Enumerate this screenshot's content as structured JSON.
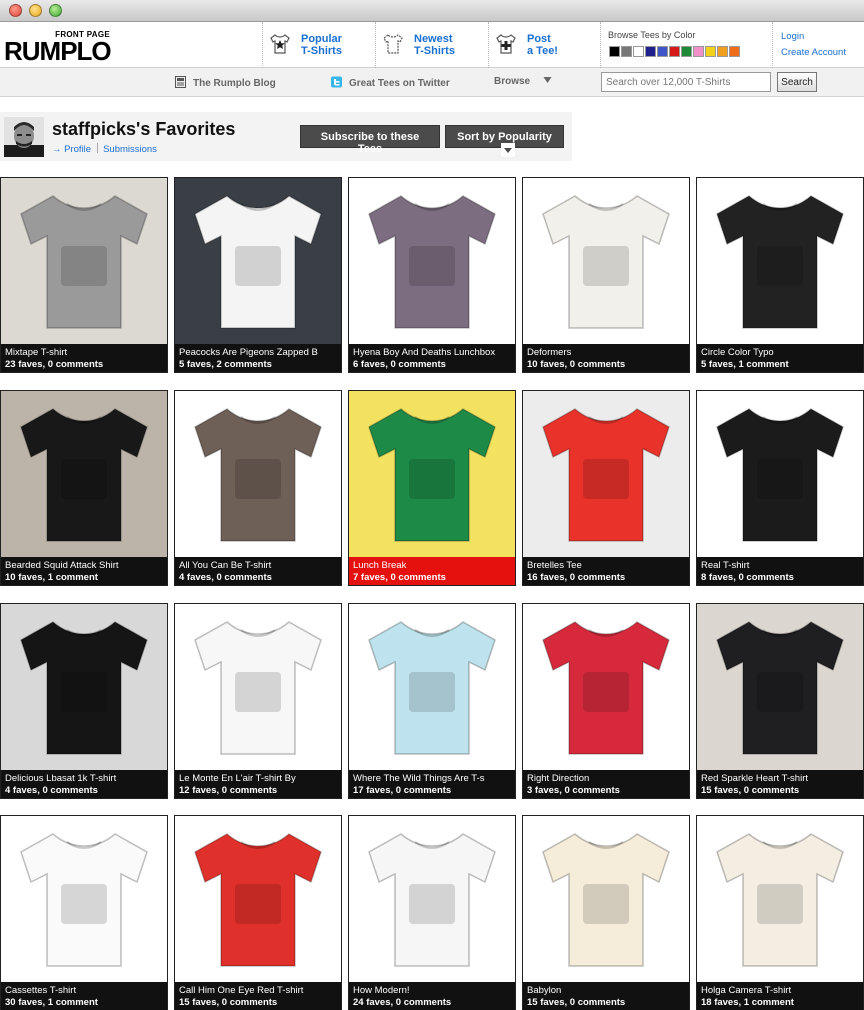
{
  "window": {
    "controls": [
      "close",
      "minimize",
      "zoom"
    ]
  },
  "header": {
    "logo_small": "FRONT PAGE",
    "logo": "RUMPLO",
    "nav": [
      {
        "label": "Popular\nT-Shirts",
        "icon": "star-shirt-icon"
      },
      {
        "label": "Newest\nT-Shirts",
        "icon": "shirt-outline-icon"
      },
      {
        "label": "Post\na Tee!",
        "icon": "plus-shirt-icon"
      }
    ],
    "browse_color_label": "Browse Tees by Color",
    "colors": [
      "#000000",
      "#777777",
      "#ffffff",
      "#1e1e8c",
      "#3d55c8",
      "#d61a1a",
      "#1f8a35",
      "#f08fc8",
      "#f2d21a",
      "#f0a01e",
      "#ee6c1a"
    ],
    "login": "Login",
    "create_account": "Create Account"
  },
  "subnav": {
    "blog": "The Rumplo Blog",
    "twitter": "Great Tees on Twitter",
    "browse": "Browse",
    "search_placeholder": "Search over 12,000 T-Shirts",
    "search_button": "Search"
  },
  "profile": {
    "title": "staffpicks's Favorites",
    "arrow": "→",
    "profile_link": "Profile",
    "submissions_link": "Submissions",
    "subscribe_button": "Subscribe to these Tees",
    "sort_button": "Sort by Popularity"
  },
  "items": [
    {
      "title": "Mixtape T-shirt",
      "meta": "23 faves, 0 comments",
      "bg": "#dcd8d2",
      "shirt": "#9a9a9a",
      "highlight": false
    },
    {
      "title": "Peacocks Are Pigeons Zapped B",
      "meta": "5 faves, 2 comments",
      "bg": "#3a3f46",
      "shirt": "#f4f4f4",
      "highlight": false
    },
    {
      "title": "Hyena Boy And Deaths Lunchbox",
      "meta": "6 faves, 0 comments",
      "bg": "#ffffff",
      "shirt": "#7d6d80",
      "highlight": false
    },
    {
      "title": "Deformers",
      "meta": "10 faves, 0 comments",
      "bg": "#ffffff",
      "shirt": "#f2f0ea",
      "highlight": false
    },
    {
      "title": "Circle Color Typo",
      "meta": "5 faves, 1 comment",
      "bg": "#ffffff",
      "shirt": "#222222",
      "highlight": false
    },
    {
      "title": "Bearded Squid Attack Shirt",
      "meta": "10 faves, 1 comment",
      "bg": "#bcb4a8",
      "shirt": "#181818",
      "highlight": false
    },
    {
      "title": "All You Can Be T-shirt",
      "meta": "4 faves, 0 comments",
      "bg": "#ffffff",
      "shirt": "#6e5f57",
      "highlight": false
    },
    {
      "title": "Lunch Break",
      "meta": "7 faves, 0 comments",
      "bg": "#f3e160",
      "shirt": "#1d8a48",
      "highlight": true
    },
    {
      "title": "Bretelles Tee",
      "meta": "16 faves, 0 comments",
      "bg": "#ececec",
      "shirt": "#e8322a",
      "highlight": false
    },
    {
      "title": "Real T-shirt",
      "meta": "8 faves, 0 comments",
      "bg": "#ffffff",
      "shirt": "#1b1b1b",
      "highlight": false
    },
    {
      "title": "Delicious Lbasat 1k T-shirt",
      "meta": "4 faves, 0 comments",
      "bg": "#d8d8d8",
      "shirt": "#151515",
      "highlight": false
    },
    {
      "title": "Le Monte En L'air T-shirt By",
      "meta": "12 faves, 0 comments",
      "bg": "#ffffff",
      "shirt": "#f7f7f7",
      "highlight": false
    },
    {
      "title": "Where The Wild Things Are T-s",
      "meta": "17 faves, 0 comments",
      "bg": "#ffffff",
      "shirt": "#bfe3ee",
      "highlight": false
    },
    {
      "title": "Right Direction",
      "meta": "3 faves, 0 comments",
      "bg": "#ffffff",
      "shirt": "#d62a3c",
      "highlight": false
    },
    {
      "title": "Red Sparkle Heart T-shirt",
      "meta": "15 faves, 0 comments",
      "bg": "#dcd6d0",
      "shirt": "#1f1f22",
      "highlight": false
    },
    {
      "title": "Cassettes T-shirt",
      "meta": "30 faves, 1 comment",
      "bg": "#ffffff",
      "shirt": "#fafafa",
      "highlight": false
    },
    {
      "title": "Call Him One Eye Red T-shirt",
      "meta": "15 faves, 0 comments",
      "bg": "#ffffff",
      "shirt": "#e0302b",
      "highlight": false
    },
    {
      "title": "How Modern!",
      "meta": "24 faves, 0 comments",
      "bg": "#ffffff",
      "shirt": "#f6f6f6",
      "highlight": false
    },
    {
      "title": "Babylon",
      "meta": "15 faves, 0 comments",
      "bg": "#ffffff",
      "shirt": "#f5ecd9",
      "highlight": false
    },
    {
      "title": "Holga Camera T-shirt",
      "meta": "18 faves, 1 comment",
      "bg": "#ffffff",
      "shirt": "#f4eee2",
      "highlight": false
    }
  ]
}
